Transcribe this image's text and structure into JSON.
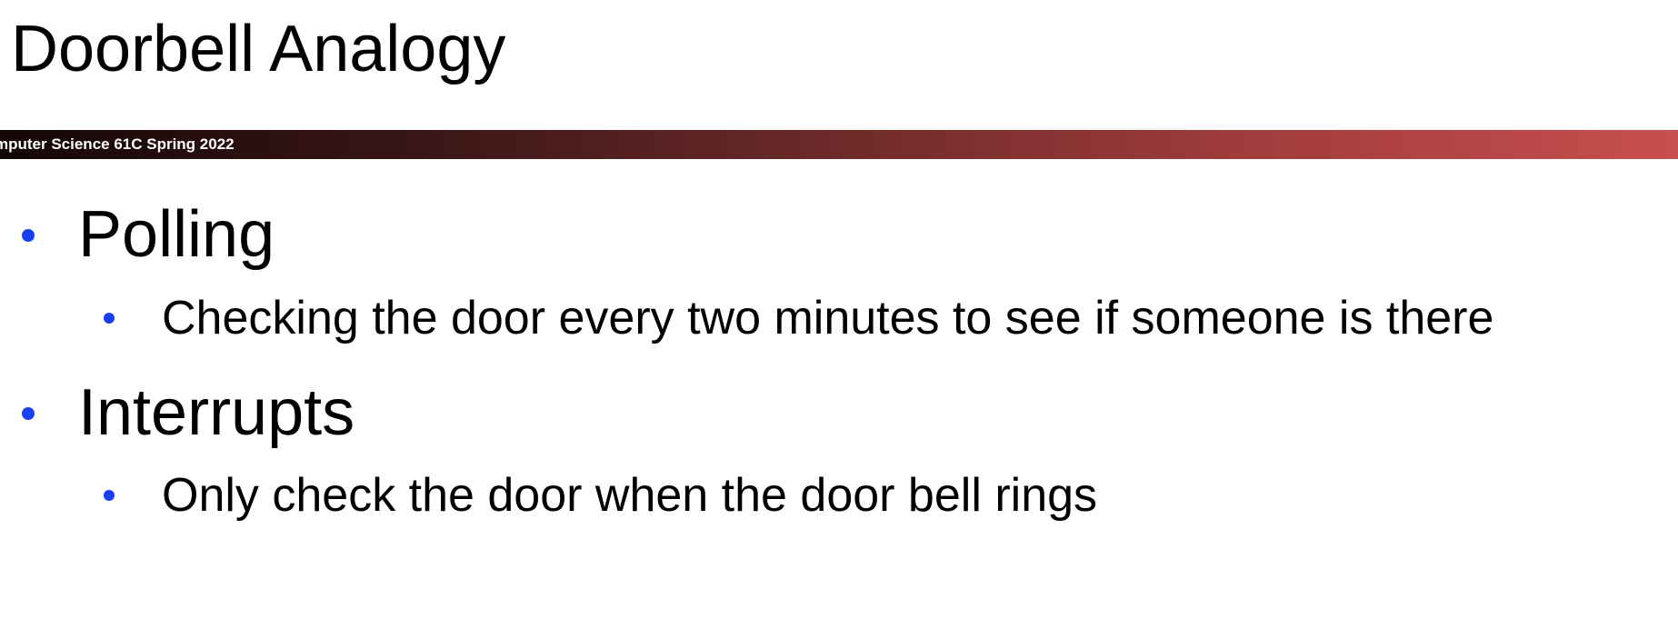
{
  "slide": {
    "title": "Doorbell Analogy",
    "banner_text": "mputer Science 61C Spring 2022",
    "colors": {
      "bullet": "#1a3ff0",
      "banner_start": "#140606",
      "banner_end": "#c84f4f",
      "text": "#000000",
      "banner_text": "#ffffff"
    },
    "bullets": [
      {
        "text": "Polling",
        "sub": "Checking the door every two minutes to see if someone is there"
      },
      {
        "text": "Interrupts",
        "sub": "Only check the door when the door bell rings"
      }
    ]
  }
}
